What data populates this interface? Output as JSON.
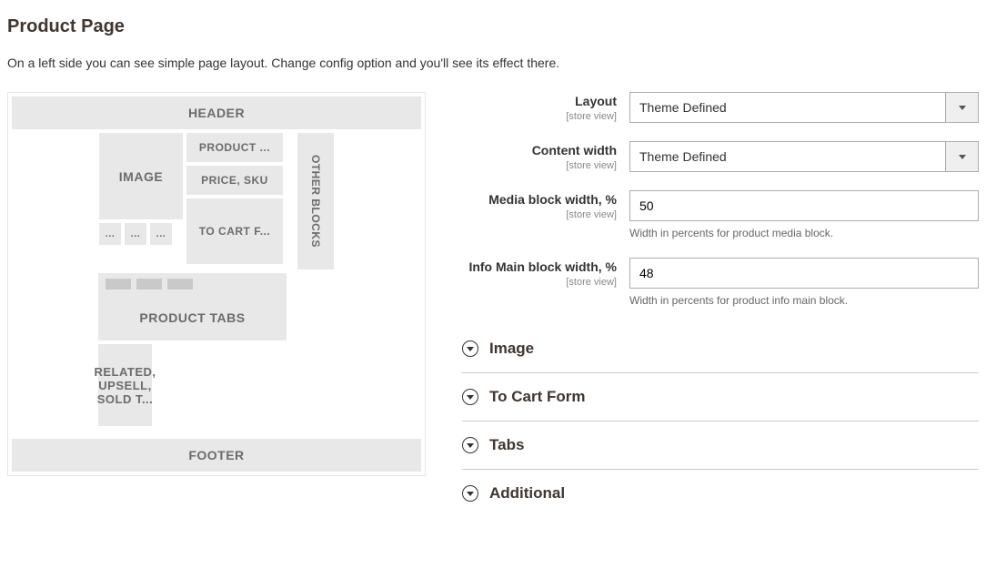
{
  "title": "Product Page",
  "description": "On a left side you can see simple page layout. Change config option and you'll see its effect there.",
  "preview": {
    "header": "HEADER",
    "image": "IMAGE",
    "thumb": "...",
    "product_title": "PRODUCT ...",
    "price_sku": "PRICE, SKU",
    "to_cart": "TO CART F...",
    "other_blocks": "OTHER BLOCKS",
    "product_tabs": "PRODUCT TABS",
    "related": "RELATED, UPSELL, SOLD T...",
    "footer": "FOOTER"
  },
  "scope_label": "[store view]",
  "fields": {
    "layout": {
      "label": "Layout",
      "value": "Theme Defined"
    },
    "content_width": {
      "label": "Content width",
      "value": "Theme Defined"
    },
    "media_width": {
      "label": "Media block width, %",
      "value": "50",
      "hint": "Width in percents for product media block."
    },
    "info_main_width": {
      "label": "Info Main block width, %",
      "value": "48",
      "hint": "Width in percents for product info main block."
    }
  },
  "accordions": {
    "image": "Image",
    "to_cart_form": "To Cart Form",
    "tabs": "Tabs",
    "additional": "Additional"
  }
}
